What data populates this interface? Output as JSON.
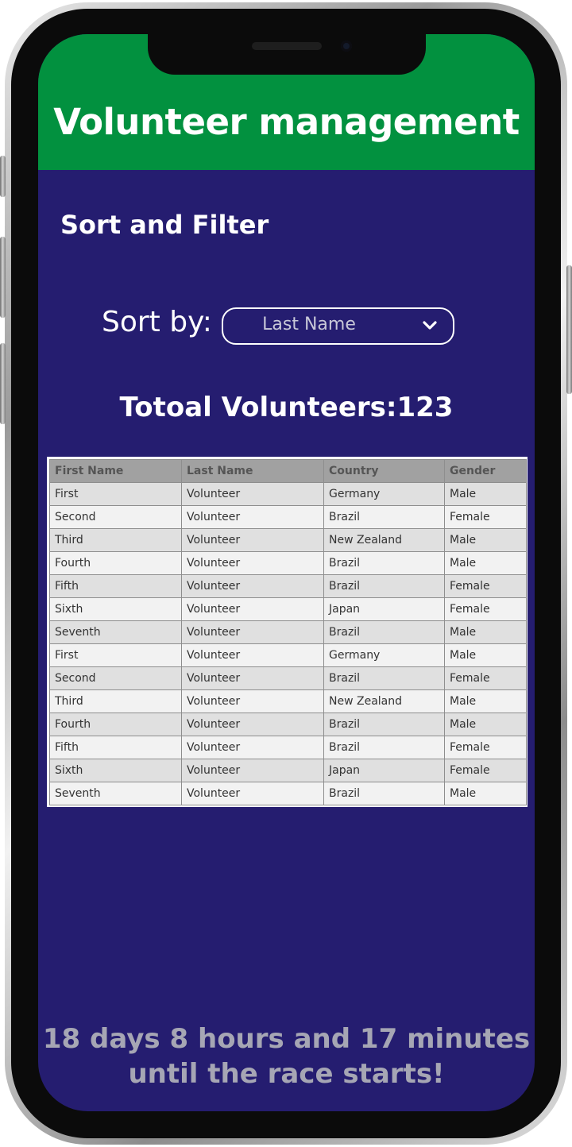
{
  "header": {
    "title": "Volunteer management"
  },
  "section": {
    "title": "Sort and Filter"
  },
  "sort": {
    "label": "Sort by:",
    "selected": "Last Name"
  },
  "summary": {
    "total_label": "Totoal Volunteers:123"
  },
  "table": {
    "columns": [
      "First Name",
      "Last Name",
      "Country",
      "Gender"
    ],
    "rows": [
      [
        "First",
        "Volunteer",
        "Germany",
        "Male"
      ],
      [
        "Second",
        "Volunteer",
        "Brazil",
        "Female"
      ],
      [
        "Third",
        "Volunteer",
        "New Zealand",
        "Male"
      ],
      [
        "Fourth",
        "Volunteer",
        "Brazil",
        "Male"
      ],
      [
        "Fifth",
        "Volunteer",
        "Brazil",
        "Female"
      ],
      [
        "Sixth",
        "Volunteer",
        "Japan",
        "Female"
      ],
      [
        "Seventh",
        "Volunteer",
        "Brazil",
        "Male"
      ],
      [
        "First",
        "Volunteer",
        "Germany",
        "Male"
      ],
      [
        "Second",
        "Volunteer",
        "Brazil",
        "Female"
      ],
      [
        "Third",
        "Volunteer",
        "New Zealand",
        "Male"
      ],
      [
        "Fourth",
        "Volunteer",
        "Brazil",
        "Male"
      ],
      [
        "Fifth",
        "Volunteer",
        "Brazil",
        "Female"
      ],
      [
        "Sixth",
        "Volunteer",
        "Japan",
        "Female"
      ],
      [
        "Seventh",
        "Volunteer",
        "Brazil",
        "Male"
      ]
    ]
  },
  "countdown": {
    "line1": "18 days 8 hours and 17 minutes",
    "line2": "until the race starts!"
  },
  "colors": {
    "header_bg": "#02913f",
    "screen_bg": "#251d70",
    "table_header_bg": "#a1a1a1",
    "countdown_text": "#a6a6b4"
  },
  "icons": {
    "dropdown": "chevron-down-icon"
  }
}
